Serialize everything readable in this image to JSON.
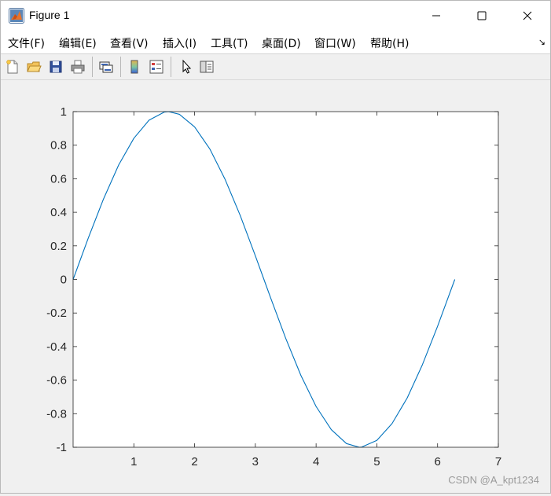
{
  "window": {
    "title": "Figure 1",
    "buttons": [
      "minimize",
      "maximize",
      "close"
    ]
  },
  "menu": {
    "items": [
      "文件(F)",
      "编辑(E)",
      "查看(V)",
      "插入(I)",
      "工具(T)",
      "桌面(D)",
      "窗口(W)",
      "帮助(H)"
    ],
    "overflow_glyph": "↘"
  },
  "toolbar": {
    "icons": [
      "new-figure-icon",
      "open-file-icon",
      "save-icon",
      "print-icon",
      "link-plot-icon",
      "colorbar-icon",
      "legend-icon",
      "pointer-icon",
      "property-editor-icon"
    ]
  },
  "chart_data": {
    "type": "line",
    "title": "",
    "xlabel": "",
    "ylabel": "",
    "xlim": [
      0,
      7
    ],
    "ylim": [
      -1,
      1
    ],
    "xticks": [
      "1",
      "2",
      "3",
      "4",
      "5",
      "6",
      "7"
    ],
    "yticks": [
      "-1",
      "-0.8",
      "-0.6",
      "-0.4",
      "-0.2",
      "0",
      "0.2",
      "0.4",
      "0.6",
      "0.8",
      "1"
    ],
    "grid": false,
    "series": [
      {
        "color": "#0072bd",
        "x": [
          0,
          0.25,
          0.5,
          0.75,
          1.0,
          1.25,
          1.5,
          1.5708,
          1.75,
          2.0,
          2.25,
          2.5,
          2.75,
          3.0,
          3.1416,
          3.25,
          3.5,
          3.75,
          4.0,
          4.25,
          4.5,
          4.7124,
          4.75,
          5.0,
          5.25,
          5.5,
          5.75,
          6.0,
          6.2832
        ],
        "y": [
          0,
          0.247,
          0.479,
          0.682,
          0.841,
          0.949,
          0.997,
          1.0,
          0.984,
          0.909,
          0.778,
          0.598,
          0.382,
          0.141,
          0,
          -0.108,
          -0.351,
          -0.572,
          -0.757,
          -0.895,
          -0.978,
          -1.0,
          -0.999,
          -0.959,
          -0.859,
          -0.706,
          -0.508,
          -0.279,
          0
        ]
      }
    ]
  },
  "watermark": "CSDN @A_kpt1234"
}
